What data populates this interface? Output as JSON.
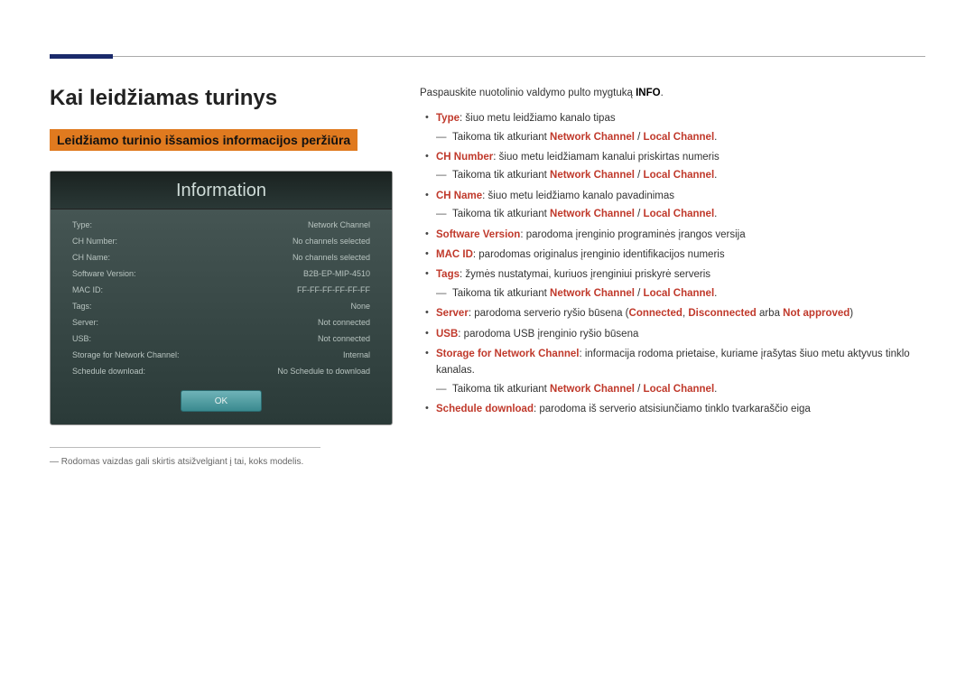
{
  "page": {
    "title": "Kai leidžiamas turinys",
    "subtitle": "Leidžiamo turinio išsamios informacijos peržiūra"
  },
  "panel": {
    "title": "Information",
    "rows": [
      {
        "label": "Type:",
        "value": "Network Channel"
      },
      {
        "label": "CH Number:",
        "value": "No channels selected"
      },
      {
        "label": "CH Name:",
        "value": "No channels selected"
      },
      {
        "label": "Software Version:",
        "value": "B2B-EP-MIP-4510"
      },
      {
        "label": "MAC ID:",
        "value": "FF-FF-FF-FF-FF-FF"
      },
      {
        "label": "Tags:",
        "value": "None"
      },
      {
        "label": "Server:",
        "value": "Not connected"
      },
      {
        "label": "USB:",
        "value": "Not connected"
      },
      {
        "label": "Storage for Network Channel:",
        "value": "Internal"
      },
      {
        "label": "Schedule download:",
        "value": "No Schedule to download"
      }
    ],
    "ok": "OK"
  },
  "footnote": "Rodomas vaizdas gali skirtis atsižvelgiant į tai, koks modelis.",
  "intro": {
    "pre": "Paspauskite nuotolinio valdymo pulto mygtuką ",
    "bold": "INFO",
    "post": "."
  },
  "sub": {
    "pre": "Taikoma tik atkuriant ",
    "a": "Network Channel",
    "sep": " / ",
    "b": "Local Channel",
    "post": "."
  },
  "items": {
    "type_label": "Type",
    "type_text": ": šiuo metu leidžiamo kanalo tipas",
    "chnum_label": "CH Number",
    "chnum_text": ": šiuo metu leidžiamam kanalui priskirtas numeris",
    "chname_label": "CH Name",
    "chname_text": ": šiuo metu leidžiamo kanalo pavadinimas",
    "sw_label": "Software Version",
    "sw_text": ": parodoma įrenginio programinės įrangos versija",
    "mac_label": "MAC ID",
    "mac_text": ": parodomas originalus įrenginio identifikacijos numeris",
    "tags_label": "Tags",
    "tags_text": ": žymės nustatymai, kuriuos įrenginiui priskyrė serveris",
    "server_label": "Server",
    "server_pre": ": parodoma serverio ryšio būsena (",
    "server_a": "Connected",
    "server_s1": ", ",
    "server_b": "Disconnected",
    "server_mid": " arba ",
    "server_c": "Not approved",
    "server_post": ")",
    "usb_label": "USB",
    "usb_text": ": parodoma USB įrenginio ryšio būsena",
    "storage_label": "Storage for Network Channel",
    "storage_text": ": informacija rodoma prietaise, kuriame įrašytas šiuo metu aktyvus tinklo kanalas.",
    "sched_label": "Schedule download",
    "sched_text": ": parodoma iš serverio atsisiunčiamo tinklo tvarkaraščio eiga"
  }
}
